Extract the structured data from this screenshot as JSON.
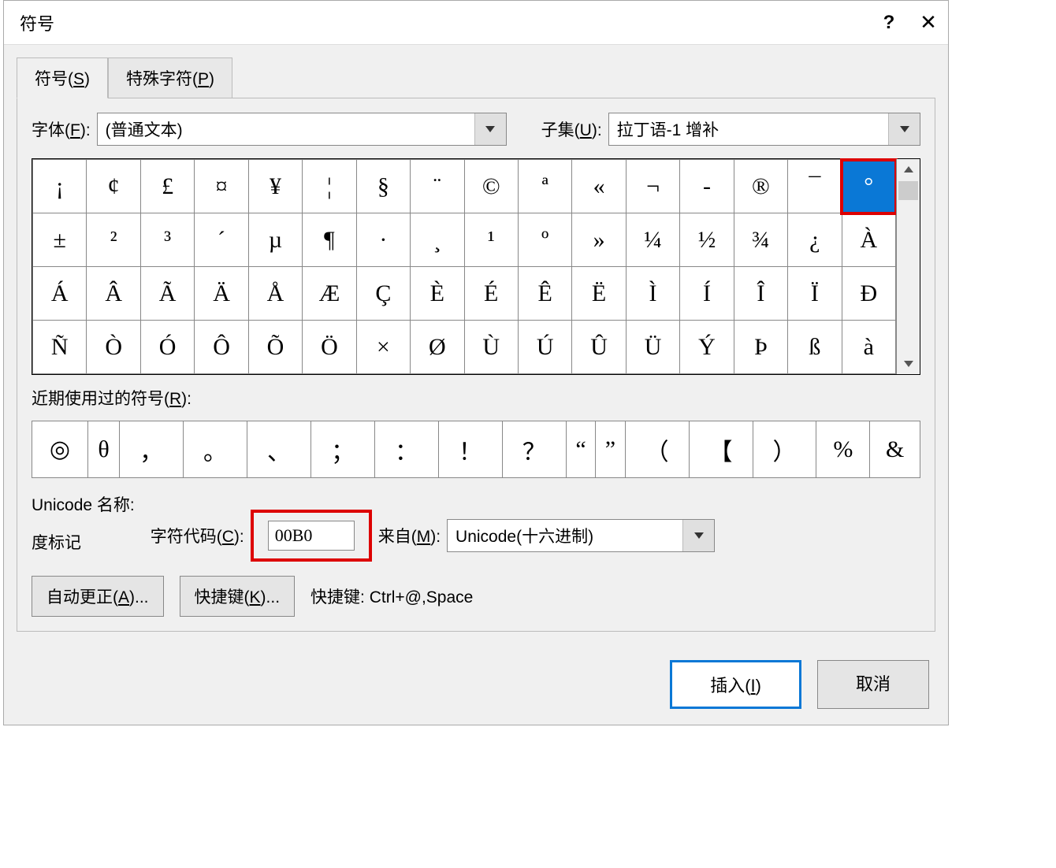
{
  "dialog": {
    "title": "符号",
    "help": "?",
    "close": "✕"
  },
  "tabs": {
    "symbols": {
      "pre": "符号(",
      "key": "S",
      "post": ")"
    },
    "special": {
      "pre": "特殊字符(",
      "key": "P",
      "post": ")"
    }
  },
  "font": {
    "label_pre": "字体(",
    "label_key": "F",
    "label_post": "):",
    "value": "(普通文本)"
  },
  "subset": {
    "label_pre": "子集(",
    "label_key": "U",
    "label_post": "):",
    "value": "拉丁语-1 增补"
  },
  "grid": [
    [
      "¡",
      "¢",
      "£",
      "¤",
      "¥",
      "¦",
      "§",
      "¨",
      "©",
      "ª",
      "«",
      "¬",
      "-",
      "®",
      "¯",
      "°"
    ],
    [
      "±",
      "²",
      "³",
      "´",
      "µ",
      "¶",
      "·",
      "¸",
      "¹",
      "º",
      "»",
      "¼",
      "½",
      "¾",
      "¿",
      "À"
    ],
    [
      "Á",
      "Â",
      "Ã",
      "Ä",
      "Å",
      "Æ",
      "Ç",
      "È",
      "É",
      "Ê",
      "Ë",
      "Ì",
      "Í",
      "Î",
      "Ï",
      "Ð"
    ],
    [
      "Ñ",
      "Ò",
      "Ó",
      "Ô",
      "Õ",
      "Ö",
      "×",
      "Ø",
      "Ù",
      "Ú",
      "Û",
      "Ü",
      "Ý",
      "Þ",
      "ß",
      "à"
    ]
  ],
  "selected": {
    "row": 0,
    "col": 15
  },
  "recent_label": {
    "pre": "近期使用过的符号(",
    "key": "R",
    "post": "):"
  },
  "recent": [
    "◎",
    "θ",
    "，",
    "。",
    "、",
    "；",
    "：",
    "！",
    "？",
    "“",
    "”",
    "（",
    "【",
    "）",
    "%",
    "&"
  ],
  "unicode_block": {
    "name_label": "Unicode 名称:",
    "desc": "度标记"
  },
  "charcode": {
    "label_pre": "字符代码(",
    "label_key": "C",
    "label_post": "):",
    "value": "00B0"
  },
  "from": {
    "label_pre": "来自(",
    "label_key": "M",
    "label_post": "):",
    "value": "Unicode(十六进制)"
  },
  "buttons": {
    "autocorrect": {
      "pre": "自动更正(",
      "key": "A",
      "post": ")..."
    },
    "shortcut": {
      "pre": "快捷键(",
      "key": "K",
      "post": ")..."
    },
    "shortcut_info": "快捷键: Ctrl+@,Space",
    "insert": {
      "pre": "插入(",
      "key": "I",
      "post": ")"
    },
    "cancel": "取消"
  }
}
